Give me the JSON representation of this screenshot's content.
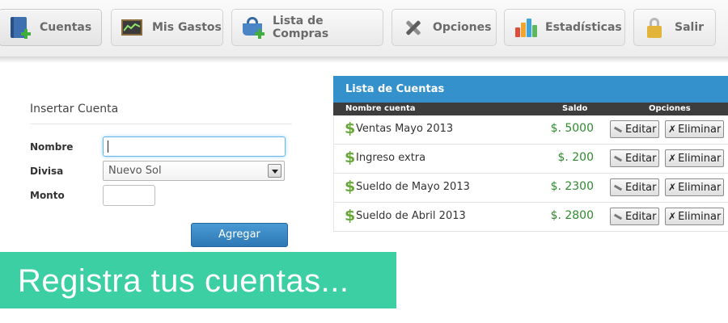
{
  "nav": {
    "items": [
      {
        "label": "Cuentas",
        "icon": "book-add-icon",
        "active": true
      },
      {
        "label": "Mis Gastos",
        "icon": "chart-board-icon"
      },
      {
        "label": "Lista de Compras",
        "icon": "basket-add-icon"
      },
      {
        "label": "Opciones",
        "icon": "tools-icon"
      },
      {
        "label": "Estadísticas",
        "icon": "bar-stats-icon"
      },
      {
        "label": "Salir",
        "icon": "lock-icon"
      }
    ]
  },
  "form": {
    "title": "Insertar Cuenta",
    "nombre_label": "Nombre",
    "nombre_value": "",
    "divisa_label": "Divisa",
    "divisa_selected": "Nuevo Sol",
    "monto_label": "Monto",
    "monto_value": "",
    "submit_label": "Agregar"
  },
  "accounts": {
    "title": "Lista de Cuentas",
    "columns": [
      "Nombre cuenta",
      "Saldo",
      "Opciones"
    ],
    "currency_symbol": "$",
    "edit_label": "Editar",
    "delete_label": "Eliminar",
    "rows": [
      {
        "name": "Ventas Mayo 2013",
        "balance": "$. 5000"
      },
      {
        "name": "Ingreso extra",
        "balance": "$. 200"
      },
      {
        "name": "Sueldo de Mayo 2013",
        "balance": "$. 2300"
      },
      {
        "name": "Sueldo de Abril 2013",
        "balance": "$. 2800"
      }
    ]
  },
  "banner": {
    "text": "Registra tus cuentas..."
  },
  "colors": {
    "accent_blue": "#3591cc",
    "balance_green": "#2e8b2e",
    "banner_teal": "#3ccfa4"
  }
}
